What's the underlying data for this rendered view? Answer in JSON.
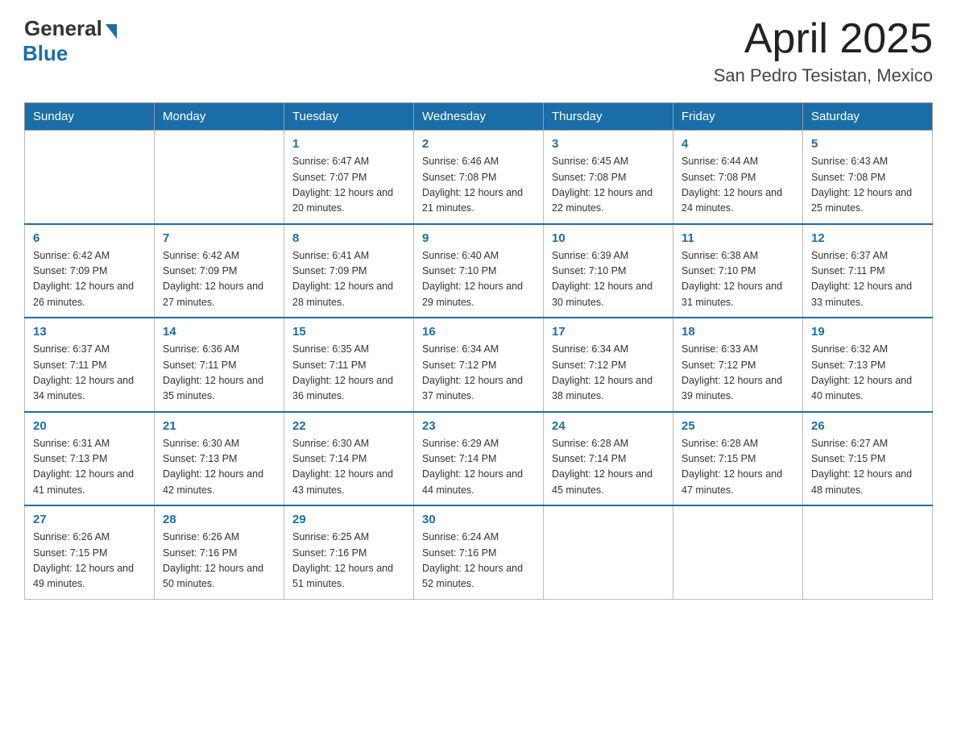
{
  "logo": {
    "text_general": "General",
    "text_blue": "Blue"
  },
  "header": {
    "title": "April 2025",
    "subtitle": "San Pedro Tesistan, Mexico"
  },
  "weekdays": [
    "Sunday",
    "Monday",
    "Tuesday",
    "Wednesday",
    "Thursday",
    "Friday",
    "Saturday"
  ],
  "weeks": [
    [
      {
        "day": "",
        "sunrise": "",
        "sunset": "",
        "daylight": ""
      },
      {
        "day": "",
        "sunrise": "",
        "sunset": "",
        "daylight": ""
      },
      {
        "day": "1",
        "sunrise": "Sunrise: 6:47 AM",
        "sunset": "Sunset: 7:07 PM",
        "daylight": "Daylight: 12 hours and 20 minutes."
      },
      {
        "day": "2",
        "sunrise": "Sunrise: 6:46 AM",
        "sunset": "Sunset: 7:08 PM",
        "daylight": "Daylight: 12 hours and 21 minutes."
      },
      {
        "day": "3",
        "sunrise": "Sunrise: 6:45 AM",
        "sunset": "Sunset: 7:08 PM",
        "daylight": "Daylight: 12 hours and 22 minutes."
      },
      {
        "day": "4",
        "sunrise": "Sunrise: 6:44 AM",
        "sunset": "Sunset: 7:08 PM",
        "daylight": "Daylight: 12 hours and 24 minutes."
      },
      {
        "day": "5",
        "sunrise": "Sunrise: 6:43 AM",
        "sunset": "Sunset: 7:08 PM",
        "daylight": "Daylight: 12 hours and 25 minutes."
      }
    ],
    [
      {
        "day": "6",
        "sunrise": "Sunrise: 6:42 AM",
        "sunset": "Sunset: 7:09 PM",
        "daylight": "Daylight: 12 hours and 26 minutes."
      },
      {
        "day": "7",
        "sunrise": "Sunrise: 6:42 AM",
        "sunset": "Sunset: 7:09 PM",
        "daylight": "Daylight: 12 hours and 27 minutes."
      },
      {
        "day": "8",
        "sunrise": "Sunrise: 6:41 AM",
        "sunset": "Sunset: 7:09 PM",
        "daylight": "Daylight: 12 hours and 28 minutes."
      },
      {
        "day": "9",
        "sunrise": "Sunrise: 6:40 AM",
        "sunset": "Sunset: 7:10 PM",
        "daylight": "Daylight: 12 hours and 29 minutes."
      },
      {
        "day": "10",
        "sunrise": "Sunrise: 6:39 AM",
        "sunset": "Sunset: 7:10 PM",
        "daylight": "Daylight: 12 hours and 30 minutes."
      },
      {
        "day": "11",
        "sunrise": "Sunrise: 6:38 AM",
        "sunset": "Sunset: 7:10 PM",
        "daylight": "Daylight: 12 hours and 31 minutes."
      },
      {
        "day": "12",
        "sunrise": "Sunrise: 6:37 AM",
        "sunset": "Sunset: 7:11 PM",
        "daylight": "Daylight: 12 hours and 33 minutes."
      }
    ],
    [
      {
        "day": "13",
        "sunrise": "Sunrise: 6:37 AM",
        "sunset": "Sunset: 7:11 PM",
        "daylight": "Daylight: 12 hours and 34 minutes."
      },
      {
        "day": "14",
        "sunrise": "Sunrise: 6:36 AM",
        "sunset": "Sunset: 7:11 PM",
        "daylight": "Daylight: 12 hours and 35 minutes."
      },
      {
        "day": "15",
        "sunrise": "Sunrise: 6:35 AM",
        "sunset": "Sunset: 7:11 PM",
        "daylight": "Daylight: 12 hours and 36 minutes."
      },
      {
        "day": "16",
        "sunrise": "Sunrise: 6:34 AM",
        "sunset": "Sunset: 7:12 PM",
        "daylight": "Daylight: 12 hours and 37 minutes."
      },
      {
        "day": "17",
        "sunrise": "Sunrise: 6:34 AM",
        "sunset": "Sunset: 7:12 PM",
        "daylight": "Daylight: 12 hours and 38 minutes."
      },
      {
        "day": "18",
        "sunrise": "Sunrise: 6:33 AM",
        "sunset": "Sunset: 7:12 PM",
        "daylight": "Daylight: 12 hours and 39 minutes."
      },
      {
        "day": "19",
        "sunrise": "Sunrise: 6:32 AM",
        "sunset": "Sunset: 7:13 PM",
        "daylight": "Daylight: 12 hours and 40 minutes."
      }
    ],
    [
      {
        "day": "20",
        "sunrise": "Sunrise: 6:31 AM",
        "sunset": "Sunset: 7:13 PM",
        "daylight": "Daylight: 12 hours and 41 minutes."
      },
      {
        "day": "21",
        "sunrise": "Sunrise: 6:30 AM",
        "sunset": "Sunset: 7:13 PM",
        "daylight": "Daylight: 12 hours and 42 minutes."
      },
      {
        "day": "22",
        "sunrise": "Sunrise: 6:30 AM",
        "sunset": "Sunset: 7:14 PM",
        "daylight": "Daylight: 12 hours and 43 minutes."
      },
      {
        "day": "23",
        "sunrise": "Sunrise: 6:29 AM",
        "sunset": "Sunset: 7:14 PM",
        "daylight": "Daylight: 12 hours and 44 minutes."
      },
      {
        "day": "24",
        "sunrise": "Sunrise: 6:28 AM",
        "sunset": "Sunset: 7:14 PM",
        "daylight": "Daylight: 12 hours and 45 minutes."
      },
      {
        "day": "25",
        "sunrise": "Sunrise: 6:28 AM",
        "sunset": "Sunset: 7:15 PM",
        "daylight": "Daylight: 12 hours and 47 minutes."
      },
      {
        "day": "26",
        "sunrise": "Sunrise: 6:27 AM",
        "sunset": "Sunset: 7:15 PM",
        "daylight": "Daylight: 12 hours and 48 minutes."
      }
    ],
    [
      {
        "day": "27",
        "sunrise": "Sunrise: 6:26 AM",
        "sunset": "Sunset: 7:15 PM",
        "daylight": "Daylight: 12 hours and 49 minutes."
      },
      {
        "day": "28",
        "sunrise": "Sunrise: 6:26 AM",
        "sunset": "Sunset: 7:16 PM",
        "daylight": "Daylight: 12 hours and 50 minutes."
      },
      {
        "day": "29",
        "sunrise": "Sunrise: 6:25 AM",
        "sunset": "Sunset: 7:16 PM",
        "daylight": "Daylight: 12 hours and 51 minutes."
      },
      {
        "day": "30",
        "sunrise": "Sunrise: 6:24 AM",
        "sunset": "Sunset: 7:16 PM",
        "daylight": "Daylight: 12 hours and 52 minutes."
      },
      {
        "day": "",
        "sunrise": "",
        "sunset": "",
        "daylight": ""
      },
      {
        "day": "",
        "sunrise": "",
        "sunset": "",
        "daylight": ""
      },
      {
        "day": "",
        "sunrise": "",
        "sunset": "",
        "daylight": ""
      }
    ]
  ]
}
